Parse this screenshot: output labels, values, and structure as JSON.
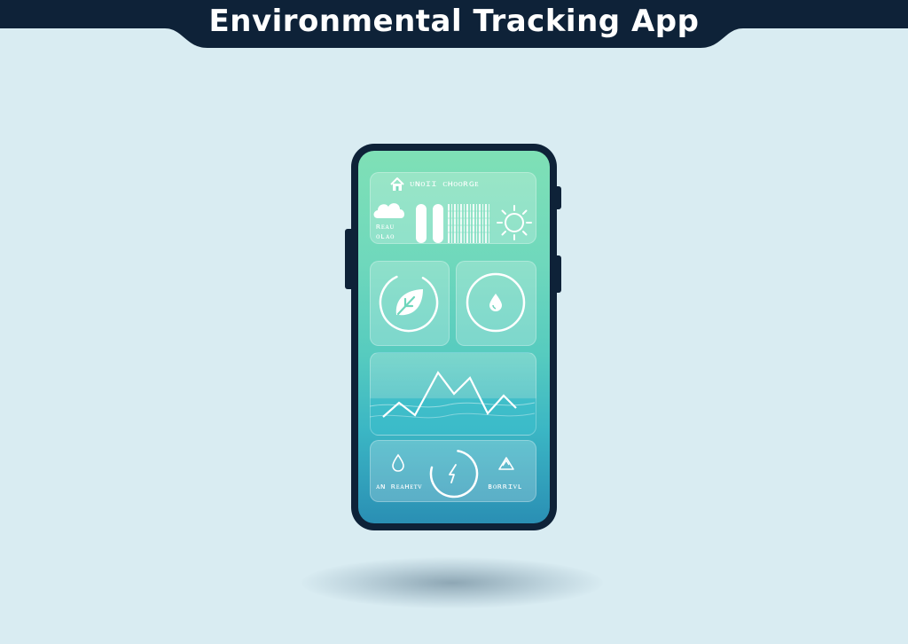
{
  "page": {
    "title": "Environmental Tracking App"
  },
  "colors": {
    "background": "#d9ecf2",
    "banner": "#0e2238",
    "phone_frame": "#0e2238",
    "screen_top": "#7fe0b6",
    "screen_bottom": "#2a8fb4",
    "foreground": "#ffffff"
  },
  "app": {
    "header": {
      "icon": "home-icon",
      "label": "ᴜɴᴏɪɪ ᴄʜᴏᴏʀɢᴇ"
    },
    "weather": {
      "icon": "cloud-icon",
      "label_line1": "ʀᴇᴀᴜ",
      "label_line2": "ᴏʟᴀᴏ",
      "sun_icon": "sun-icon"
    },
    "tiles": [
      {
        "icon": "leaf-icon",
        "name": "leaf-tile"
      },
      {
        "icon": "water-drop-icon",
        "name": "water-tile"
      }
    ],
    "graph": {
      "icon": "line-graph-icon"
    },
    "bottom": {
      "left_icon": "water-drop-icon",
      "center_icon": "lightning-icon",
      "right_icon": "recycle-icon",
      "left_label": "ᴀɴ ʀᴇᴀʜᴇᴛᴠ",
      "right_label": "ʙᴏʀʀɪᴠʟ"
    }
  }
}
